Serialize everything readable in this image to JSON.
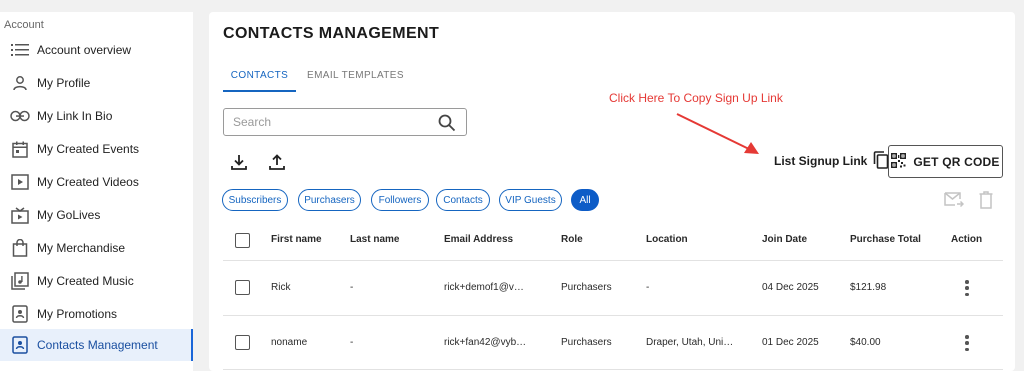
{
  "sidebar": {
    "heading": "Account",
    "items": [
      {
        "label": "Account overview",
        "icon": "list-icon"
      },
      {
        "label": "My Profile",
        "icon": "person-icon"
      },
      {
        "label": "My Link In Bio",
        "icon": "link-icon"
      },
      {
        "label": "My Created Events",
        "icon": "calendar-icon"
      },
      {
        "label": "My Created Videos",
        "icon": "video-icon"
      },
      {
        "label": "My GoLives",
        "icon": "tv-icon"
      },
      {
        "label": "My Merchandise",
        "icon": "bag-icon"
      },
      {
        "label": "My Created Music",
        "icon": "music-icon"
      },
      {
        "label": "My Promotions",
        "icon": "promotion-icon"
      },
      {
        "label": "Contacts Management",
        "icon": "contacts-icon",
        "active": true
      }
    ]
  },
  "main": {
    "title": "CONTACTS MANAGEMENT",
    "tabs": [
      {
        "label": "CONTACTS",
        "active": true
      },
      {
        "label": "EMAIL TEMPLATES",
        "active": false
      }
    ],
    "search": {
      "placeholder": "Search",
      "value": ""
    },
    "annotation": "Click Here To Copy Sign Up Link",
    "signup_link_label": "List Signup Link",
    "qr_button_label": "GET QR CODE",
    "filters": [
      {
        "label": "Subscribers",
        "active": false
      },
      {
        "label": "Purchasers",
        "active": false
      },
      {
        "label": "Followers",
        "active": false
      },
      {
        "label": "Contacts",
        "active": false
      },
      {
        "label": "VIP Guests",
        "active": false
      },
      {
        "label": "All",
        "active": true
      }
    ],
    "table": {
      "columns": [
        "First name",
        "Last name",
        "Email Address",
        "Role",
        "Location",
        "Join Date",
        "Purchase Total",
        "Action"
      ],
      "rows": [
        {
          "first": "Rick",
          "last": "-",
          "email": "rick+demof1@v…",
          "role": "Purchasers",
          "location": "-",
          "join": "04 Dec 2025",
          "total": "$121.98"
        },
        {
          "first": "noname",
          "last": "-",
          "email": "rick+fan42@vyb…",
          "role": "Purchasers",
          "location": "Draper, Utah, Uni…",
          "join": "01 Dec 2025",
          "total": "$40.00"
        }
      ]
    }
  },
  "colors": {
    "accent": "#1565c0",
    "annotation": "#e53935",
    "active_bg": "#e8f0fb"
  }
}
